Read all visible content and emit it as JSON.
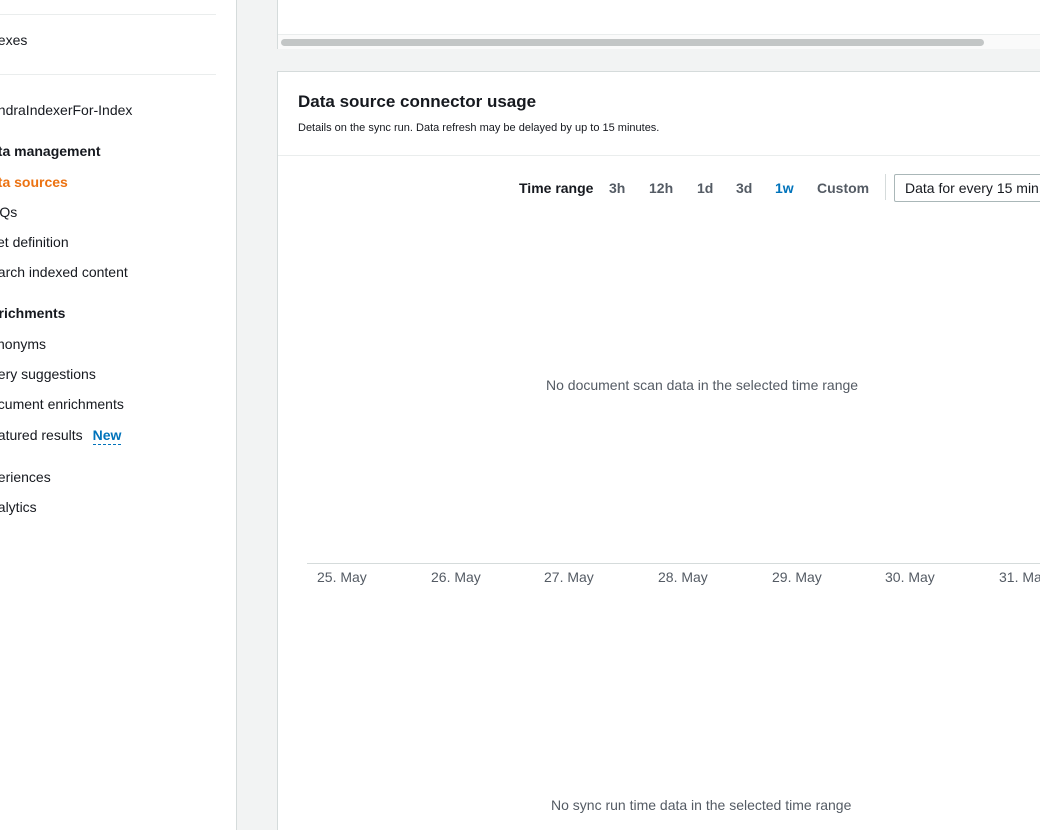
{
  "sidebar": {
    "indexes_label": "dexes",
    "index_name": "endraIndexerFor-Index",
    "data_management": {
      "heading": "ata management",
      "items": [
        "ata sources",
        "AQs",
        "cet definition",
        "earch indexed content"
      ]
    },
    "enrichments": {
      "heading": "nrichments",
      "items": [
        "ynonyms",
        "uery suggestions",
        "ocument enrichments",
        "eatured results"
      ],
      "new_badge": "New"
    },
    "experiences_label": "periences",
    "analytics_label": "nalytics"
  },
  "card": {
    "title": "Data source connector usage",
    "description": "Details on the sync run. Data refresh may be delayed by up to 15 minutes.",
    "time_range_label": "Time range",
    "time_options": [
      "3h",
      "12h",
      "1d",
      "3d",
      "1w",
      "Custom"
    ],
    "selected_option": "1w",
    "interval_select": "Data for every 15 min",
    "empty_scan_message": "No document scan data in the selected time range",
    "empty_sync_message": "No sync run time data in the selected time range",
    "x_ticks": [
      "25. May",
      "26. May",
      "27. May",
      "28. May",
      "29. May",
      "30. May",
      "31. Ma"
    ]
  },
  "colors": {
    "accent_orange": "#ec7211",
    "link_blue": "#0073bb",
    "border": "#d5dbdb"
  }
}
